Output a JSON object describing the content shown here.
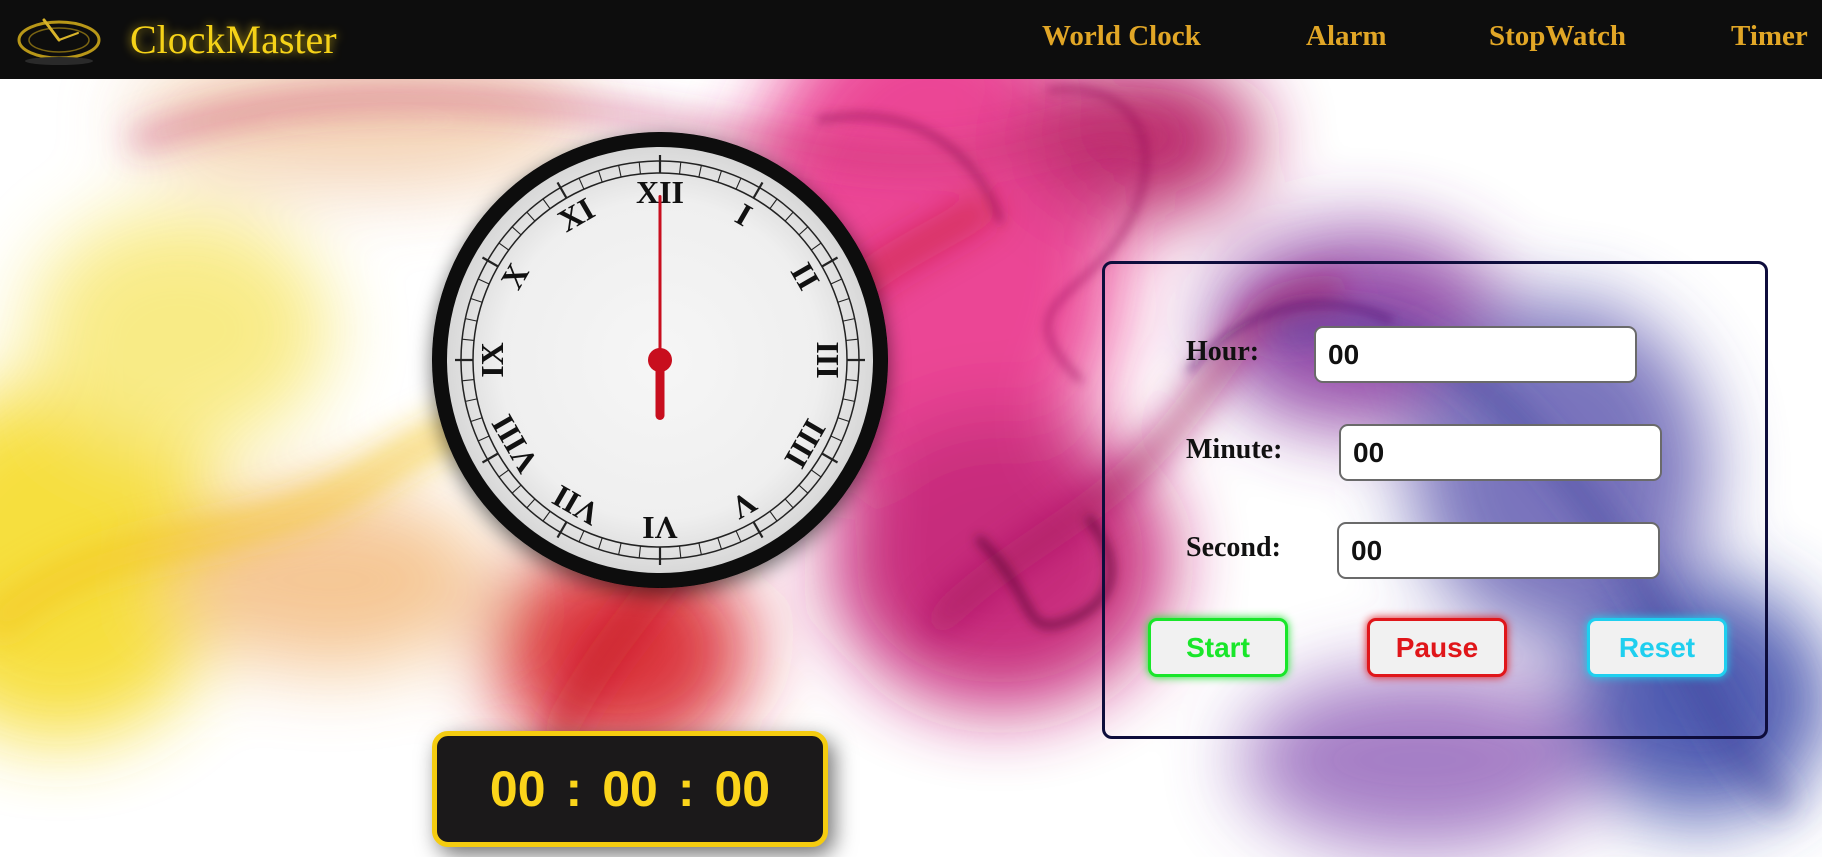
{
  "app": {
    "brand": "ClockMaster"
  },
  "nav": {
    "items": [
      {
        "id": "world-clock",
        "label": "World Clock"
      },
      {
        "id": "alarm",
        "label": "Alarm"
      },
      {
        "id": "stopwatch",
        "label": "StopWatch"
      },
      {
        "id": "timer",
        "label": "Timer"
      }
    ]
  },
  "clock": {
    "numerals": [
      "XII",
      "I",
      "II",
      "III",
      "IIII",
      "V",
      "VI",
      "VII",
      "VIII",
      "IX",
      "X",
      "XI"
    ],
    "time": {
      "hour": 6,
      "minute": 0,
      "second": 0
    },
    "hand_color": "#c80e1e"
  },
  "display": {
    "hours": "00",
    "minutes": "00",
    "seconds": "00",
    "separator": ":"
  },
  "timer": {
    "hour": {
      "label": "Hour:",
      "value": "00"
    },
    "minute": {
      "label": "Minute:",
      "value": "00"
    },
    "second": {
      "label": "Second:",
      "value": "00"
    },
    "buttons": {
      "start": "Start",
      "pause": "Pause",
      "reset": "Reset"
    }
  },
  "colors": {
    "brand": "#f5d218",
    "nav_link": "#e1a626",
    "display_text": "#fbd41a",
    "start": "#19e62a",
    "pause": "#e0161a",
    "reset": "#1fcfef",
    "panel_border": "#0e0d3c"
  }
}
